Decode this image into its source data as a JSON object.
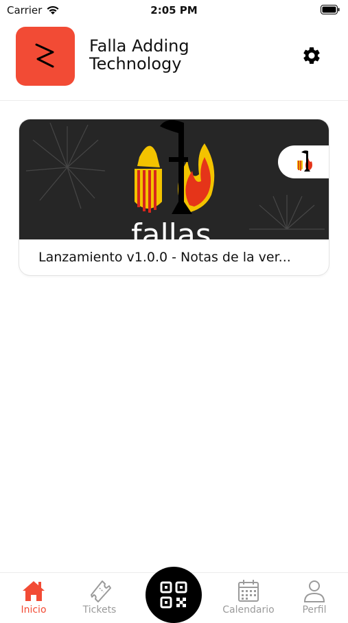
{
  "status_bar": {
    "carrier": "Carrier",
    "time": "2:05 PM"
  },
  "header": {
    "app_name": "Falla Adding Technology",
    "settings_icon": "gear-icon"
  },
  "card": {
    "title": "Lanzamiento v1.0.0 - Notas de la ver...",
    "image_text": "fallas",
    "image_letter": "f"
  },
  "tabs": [
    {
      "label": "Inicio",
      "icon": "home-icon",
      "active": true
    },
    {
      "label": "Tickets",
      "icon": "ticket-icon",
      "active": false
    },
    {
      "label": "Calendario",
      "icon": "calendar-icon",
      "active": false
    },
    {
      "label": "Perfil",
      "icon": "person-icon",
      "active": false
    }
  ],
  "colors": {
    "accent": "#f24b35",
    "muted": "#9a9a9a",
    "dark": "#262626"
  }
}
